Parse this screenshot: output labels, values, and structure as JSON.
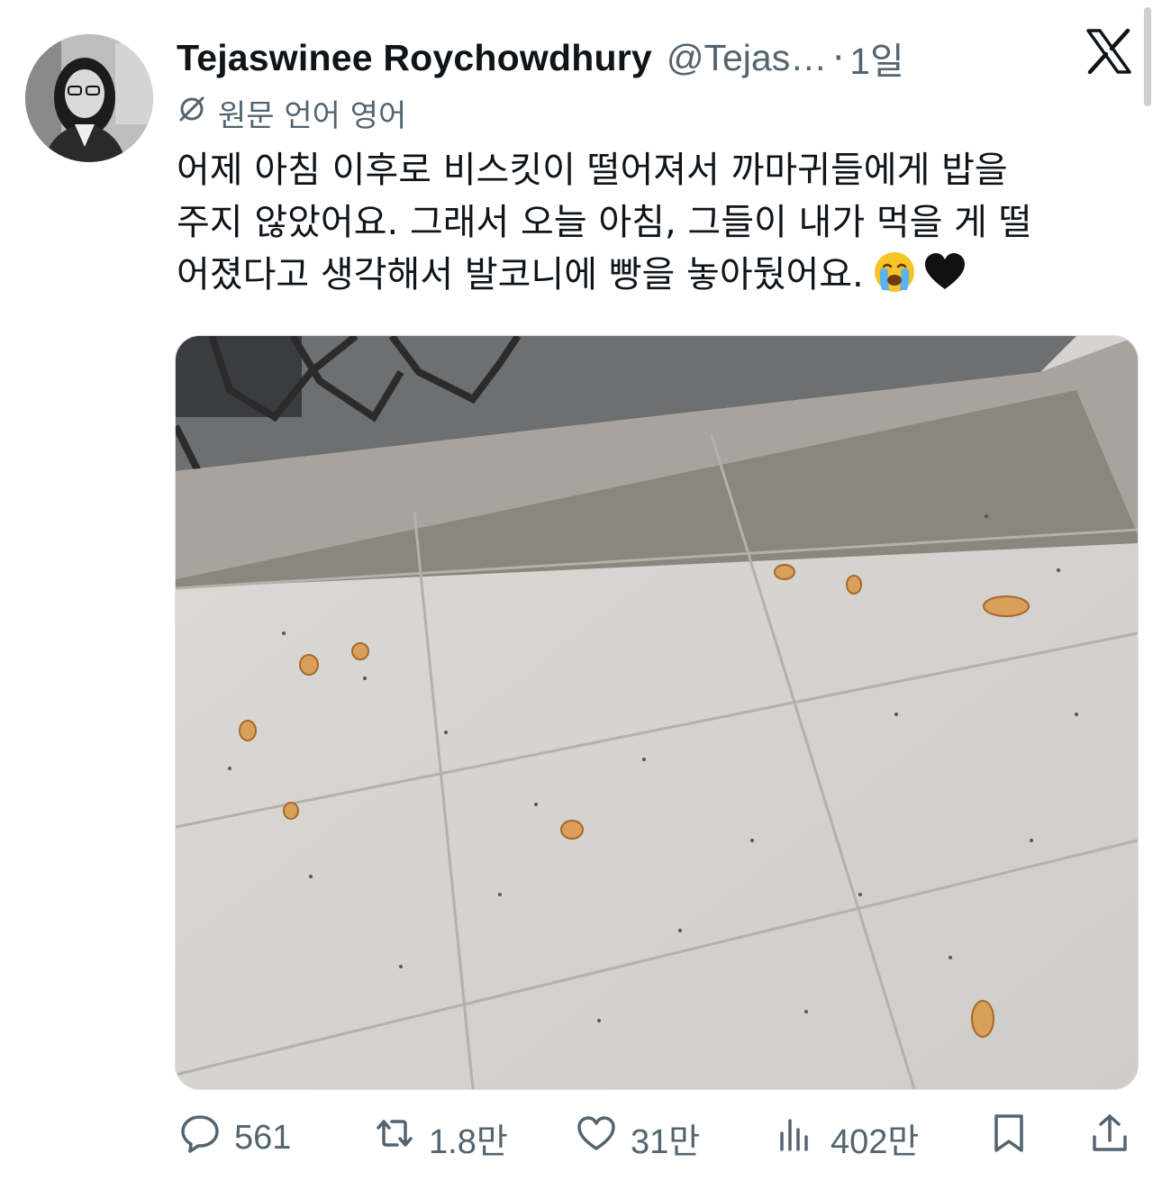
{
  "tweet": {
    "author_name": "Tejaswinee Roychowdhury",
    "author_handle": "@Tejas…",
    "separator": "·",
    "time": "1일",
    "translation_note": "원문 언어 영어",
    "body_lines": [
      "어제 아침 이후로 비스킷이 떨어져서 까마귀들에게 밥을",
      "주지 않았어요. 그래서 오늘 아침, 그들이 내가 먹을 게 떨",
      "어졌다고 생각해서 발코니에 빵을 놓아뒀어요."
    ],
    "emojis": [
      "crying-face",
      "black-heart"
    ]
  },
  "actions": {
    "reply_count": "561",
    "retweet_count": "1.8만",
    "like_count": "31만",
    "views_count": "402만"
  },
  "icons": {
    "logo": "x-logo",
    "translate": "translate-icon",
    "reply": "reply-icon",
    "retweet": "retweet-icon",
    "like": "heart-icon",
    "views": "views-icon",
    "bookmark": "bookmark-icon",
    "share": "share-icon"
  },
  "colors": {
    "text": "#0f1419",
    "muted": "#536471",
    "background": "#ffffff"
  }
}
